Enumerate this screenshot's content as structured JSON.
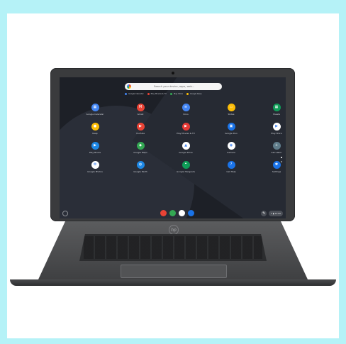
{
  "search": {
    "placeholder": "Search your device, apps, web..."
  },
  "suggestions": [
    {
      "label": "Google Calendar",
      "color": "#4285f4"
    },
    {
      "label": "Play Movies & TV",
      "color": "#ea4335"
    },
    {
      "label": "Play Store",
      "color": "#34a853"
    },
    {
      "label": "Google Keep",
      "color": "#fbbc05"
    }
  ],
  "apps": [
    {
      "label": "Google Calendar",
      "icon": "calendar-icon",
      "color": "#4285f4",
      "glyph": "▦"
    },
    {
      "label": "Gmail",
      "icon": "gmail-icon",
      "color": "#ea4335",
      "glyph": "M"
    },
    {
      "label": "Docs",
      "icon": "docs-icon",
      "color": "#4285f4",
      "glyph": "≡"
    },
    {
      "label": "Slides",
      "icon": "slides-icon",
      "color": "#fbbc05",
      "glyph": "▭"
    },
    {
      "label": "Sheets",
      "icon": "sheets-icon",
      "color": "#0f9d58",
      "glyph": "▦"
    },
    {
      "label": "Keep",
      "icon": "keep-icon",
      "color": "#fbbc05",
      "glyph": "●"
    },
    {
      "label": "YouTube",
      "icon": "youtube-icon",
      "color": "#ea4335",
      "glyph": "▶"
    },
    {
      "label": "Play Movies & TV",
      "icon": "play-movies-icon",
      "color": "#e53935",
      "glyph": "▶"
    },
    {
      "label": "Google Duo",
      "icon": "duo-icon",
      "color": "#1a73e8",
      "glyph": "▣"
    },
    {
      "label": "Play Store",
      "icon": "play-store-icon",
      "color": "#ffffff",
      "glyph": "▶"
    },
    {
      "label": "Play Books",
      "icon": "play-books-icon",
      "color": "#1e88e5",
      "glyph": "▶"
    },
    {
      "label": "Google Maps",
      "icon": "maps-icon",
      "color": "#34a853",
      "glyph": "◆"
    },
    {
      "label": "Google Drive",
      "icon": "drive-icon",
      "color": "#ffffff",
      "glyph": "▲"
    },
    {
      "label": "Camera",
      "icon": "camera-icon",
      "color": "#ffffff",
      "glyph": "◉"
    },
    {
      "label": "Calculator",
      "icon": "calculator-icon",
      "color": "#607d8b",
      "glyph": "+"
    },
    {
      "label": "Google Photos",
      "icon": "photos-icon",
      "color": "#ffffff",
      "glyph": "✿"
    },
    {
      "label": "Google Earth",
      "icon": "earth-icon",
      "color": "#1e88e5",
      "glyph": "◍"
    },
    {
      "label": "Google Hangouts",
      "icon": "hangouts-icon",
      "color": "#0f9d58",
      "glyph": "❝"
    },
    {
      "label": "Get Help",
      "icon": "help-icon",
      "color": "#1a73e8",
      "glyph": "?"
    },
    {
      "label": "Settings",
      "icon": "settings-icon",
      "color": "#1a73e8",
      "glyph": "✱"
    }
  ],
  "shelf": [
    {
      "icon": "chrome-icon",
      "color": "#ea4335"
    },
    {
      "icon": "play-store-icon",
      "color": "#34a853"
    },
    {
      "icon": "docs-icon",
      "color": "#ffffff"
    },
    {
      "icon": "duo-icon",
      "color": "#1a73e8"
    }
  ],
  "tray": {
    "status": "▾ ▮ 12:00"
  },
  "brand": {
    "logo": "hp"
  }
}
